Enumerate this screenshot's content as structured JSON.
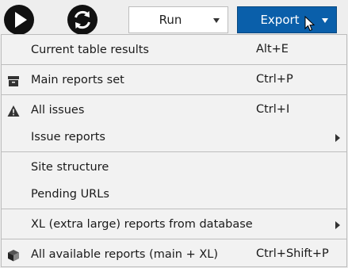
{
  "toolbar": {
    "play_icon": "play-icon",
    "refresh_icon": "refresh-icon",
    "run_label": "Run",
    "export_label": "Export",
    "accent_color": "#0a5faa"
  },
  "menu": {
    "items": [
      {
        "label": "Current table results",
        "shortcut": "Alt+E",
        "icon": ""
      },
      {
        "label": "Main reports set",
        "shortcut": "Ctrl+P",
        "icon": "archive-box-icon"
      },
      {
        "label": "All issues",
        "shortcut": "Ctrl+I",
        "icon": "warning-icon"
      },
      {
        "label": "Issue reports",
        "shortcut": "",
        "icon": "",
        "submenu": true
      },
      {
        "label": "Site structure",
        "shortcut": "",
        "icon": ""
      },
      {
        "label": "Pending URLs",
        "shortcut": "",
        "icon": ""
      },
      {
        "label": "XL (extra large) reports from database",
        "shortcut": "",
        "icon": "",
        "submenu": true
      },
      {
        "label": "All available reports (main + XL)",
        "shortcut": "Ctrl+Shift+P",
        "icon": "cube-icon"
      }
    ]
  }
}
